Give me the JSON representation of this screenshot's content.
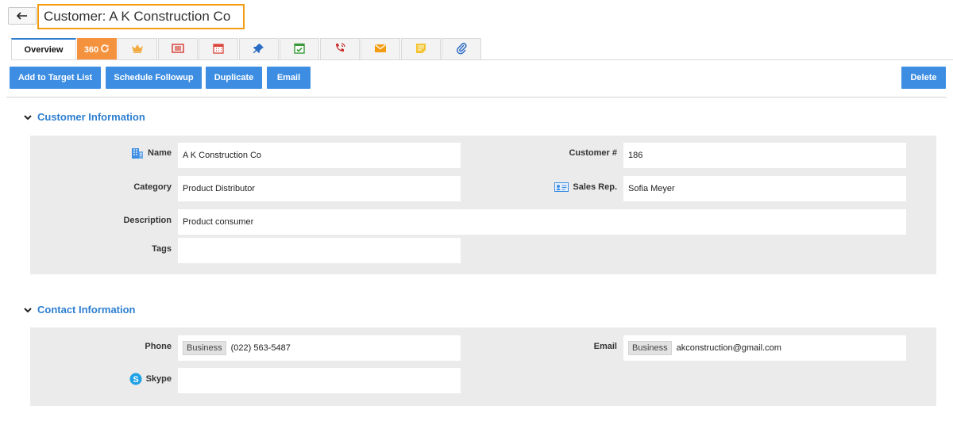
{
  "header": {
    "back_icon": "back-arrow-icon",
    "title": "Customer: A K Construction Co"
  },
  "tabs": [
    {
      "label": "Overview",
      "icon": null
    },
    {
      "label": "360",
      "icon": "refresh-icon"
    },
    {
      "label": "",
      "icon": "crown-icon"
    },
    {
      "label": "",
      "icon": "list-icon"
    },
    {
      "label": "",
      "icon": "calendar-icon"
    },
    {
      "label": "",
      "icon": "pin-icon"
    },
    {
      "label": "",
      "icon": "task-check-icon"
    },
    {
      "label": "",
      "icon": "phone-call-icon"
    },
    {
      "label": "",
      "icon": "mail-icon"
    },
    {
      "label": "",
      "icon": "note-icon"
    },
    {
      "label": "",
      "icon": "paperclip-icon"
    }
  ],
  "toolbar": {
    "add_target": "Add to Target List",
    "schedule": "Schedule Followup",
    "duplicate": "Duplicate",
    "email": "Email",
    "delete": "Delete"
  },
  "customer_info": {
    "heading": "Customer Information",
    "name_label": "Name",
    "name_value": "A K Construction Co",
    "customer_no_label": "Customer #",
    "customer_no_value": "186",
    "category_label": "Category",
    "category_value": "Product Distributor",
    "sales_rep_label": "Sales Rep.",
    "sales_rep_value": "Sofia Meyer",
    "description_label": "Description",
    "description_value": "Product consumer",
    "tags_label": "Tags",
    "tags_value": ""
  },
  "contact_info": {
    "heading": "Contact Information",
    "phone_label": "Phone",
    "phone_type": "Business",
    "phone_value": "(022) 563-5487",
    "email_label": "Email",
    "email_type": "Business",
    "email_value": "akconstruction@gmail.com",
    "skype_label": "Skype",
    "skype_value": ""
  },
  "colors": {
    "accent": "#3d8ee3",
    "title_border": "#f39c12",
    "tab_360": "#f5923e",
    "section_heading": "#2d7fd0",
    "panel_bg": "#ebebeb"
  }
}
